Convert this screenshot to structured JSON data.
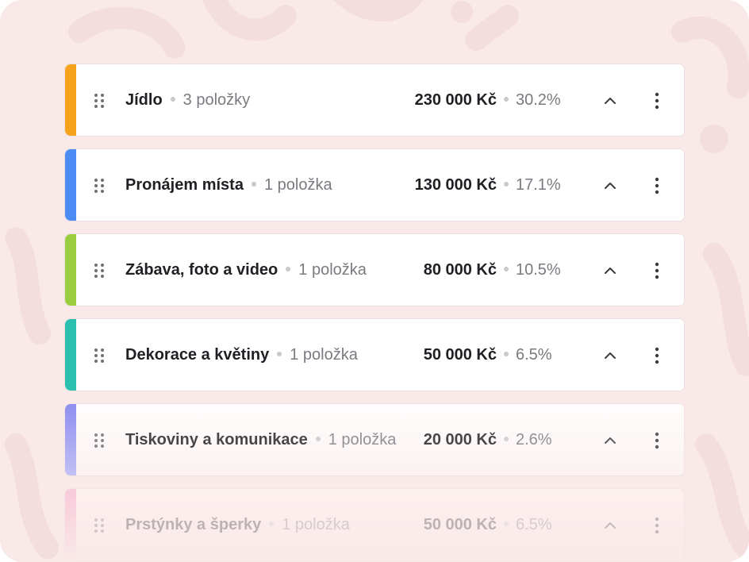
{
  "categories": [
    {
      "name": "Jídlo",
      "count": "3 položky",
      "amount": "230 000 Kč",
      "percent": "30.2%",
      "color": "#f6a21c"
    },
    {
      "name": "Pronájem místa",
      "count": "1 položka",
      "amount": "130 000 Kč",
      "percent": "17.1%",
      "color": "#4d8bf5"
    },
    {
      "name": "Zábava, foto a video",
      "count": "1 položka",
      "amount": "80 000 Kč",
      "percent": "10.5%",
      "color": "#9acd3f"
    },
    {
      "name": "Dekorace a květiny",
      "count": "1 položka",
      "amount": "50 000 Kč",
      "percent": "6.5%",
      "color": "#2bbfae"
    },
    {
      "name": "Tiskoviny a komunikace",
      "count": "1 položka",
      "amount": "20 000 Kč",
      "percent": "2.6%",
      "color": "#8f8ff0"
    },
    {
      "name": "Prstýnky a šperky",
      "count": "1 položka",
      "amount": "50 000 Kč",
      "percent": "6.5%",
      "color": "#f39abf"
    }
  ],
  "icons": {
    "drag": "drag-handle-icon",
    "collapse": "chevron-up-icon",
    "menu": "more-vertical-icon"
  },
  "background_color": "#f9e9e8"
}
